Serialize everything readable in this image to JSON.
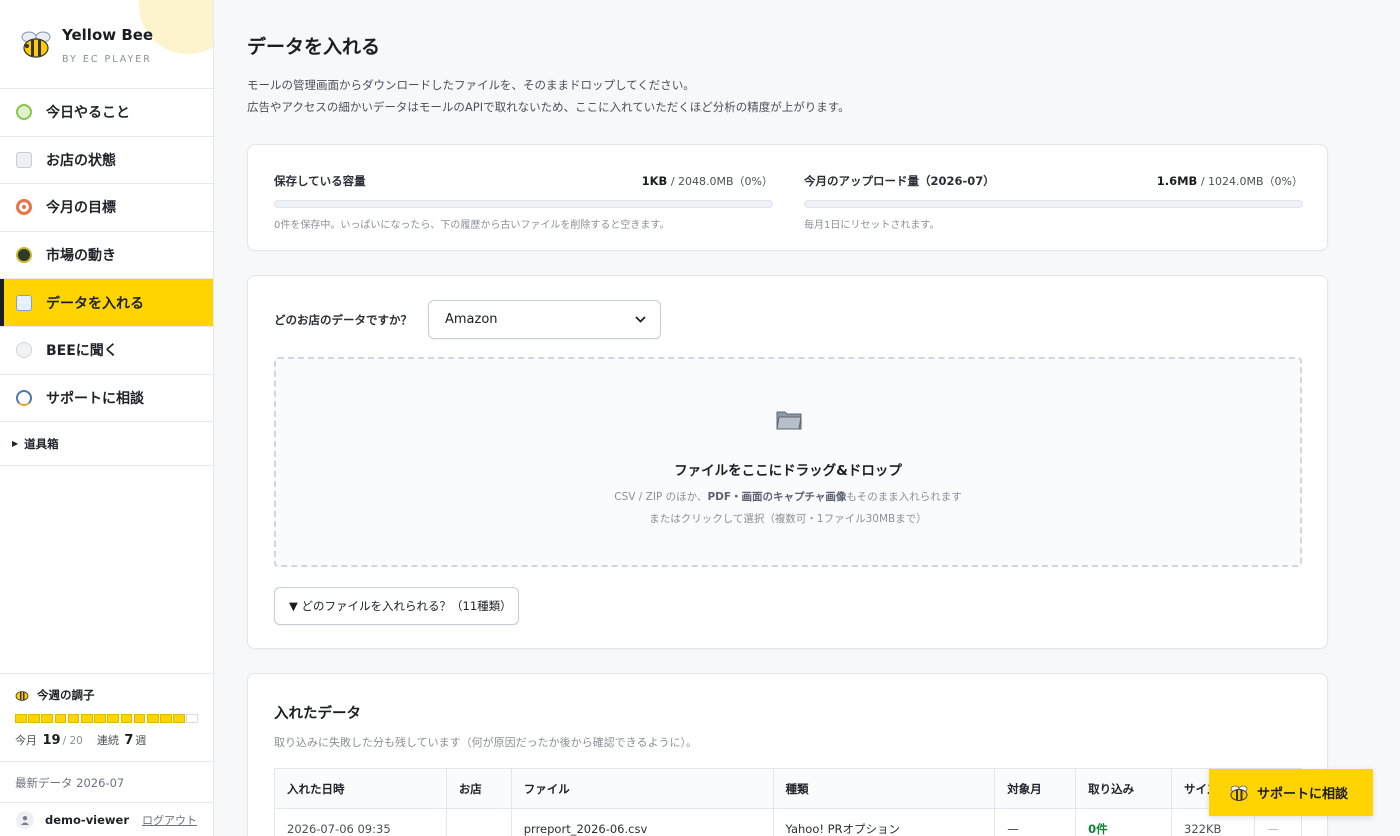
{
  "brand": {
    "name": "Yellow Bee",
    "sub": "BY EC PLAYER"
  },
  "nav": [
    {
      "label": "今日やること",
      "icon": "checkbox-icon",
      "color": "#8bc34a",
      "active": false
    },
    {
      "label": "お店の状態",
      "icon": "chart-icon",
      "color": "#c9ced6",
      "active": false
    },
    {
      "label": "今月の目標",
      "icon": "target-icon",
      "color": "#e8734a",
      "active": false
    },
    {
      "label": "市場の動き",
      "icon": "trend-icon",
      "color": "#2f3a2a",
      "active": false
    },
    {
      "label": "データを入れる",
      "icon": "inbox-icon",
      "color": "#6fa8dc",
      "active": true
    },
    {
      "label": "BEEに聞く",
      "icon": "chat-icon",
      "color": "#d0d4da",
      "active": false
    },
    {
      "label": "サポートに相談",
      "icon": "headset-icon",
      "color": "#4a7aa8",
      "active": false
    }
  ],
  "toolbox": {
    "label": "道具箱"
  },
  "weekly": {
    "title": "今週の調子",
    "segments_filled": 13,
    "segments_total": 14,
    "month_label": "今月",
    "month_value": "19",
    "month_total": "/ 20",
    "streak_label": "連続",
    "streak_value": "7",
    "streak_unit": "週"
  },
  "latest": {
    "text": "最新データ 2026-07"
  },
  "user": {
    "name": "demo-viewer",
    "logout": "ログアウト"
  },
  "page": {
    "title": "データを入れる",
    "desc1": "モールの管理画面からダウンロードしたファイルを、そのままドロップしてください。",
    "desc2": "広告やアクセスの細かいデータはモールのAPIで取れないため、ここに入れていただくほど分析の精度が上がります。"
  },
  "storage": {
    "label": "保存している容量",
    "used": "1KB",
    "total": "/ 2048.0MB（0%）",
    "percent": 0,
    "note": "0件を保存中。いっぱいになったら、下の履歴から古いファイルを削除すると空きます。"
  },
  "upload_quota": {
    "label": "今月のアップロード量（2026-07）",
    "used": "1.6MB",
    "total": "/ 1024.0MB（0%）",
    "percent": 0,
    "note": "毎月1日にリセットされます。"
  },
  "shop": {
    "label": "どのお店のデータですか？",
    "selected": "Amazon"
  },
  "dropzone": {
    "title": "ファイルをここにドラッグ&ドロップ",
    "line1_pre": "CSV / ZIP のほか、",
    "line1_bold": "PDF・画面のキャプチャ画像",
    "line1_post": "もそのまま入れられます",
    "line2": "またはクリックして選択（複数可・1ファイル30MBまで）"
  },
  "types_button": {
    "label": "▼ どのファイルを入れられる？（11種類）"
  },
  "data_section": {
    "title": "入れたデータ",
    "desc": "取り込みに失敗した分も残しています（何が原因だったか後から確認できるように）。",
    "columns": [
      "入れた日時",
      "お店",
      "ファイル",
      "種類",
      "対象月",
      "取り込み",
      "サイズ",
      ""
    ],
    "rows": [
      {
        "date": "2026-07-06 09:35",
        "shop": "",
        "file": "prreport_2026-06.csv",
        "type": "Yahoo! PRオプション",
        "month": "—",
        "imported": "0件",
        "size": "322KB",
        "action": "—"
      }
    ]
  },
  "support_float": {
    "label": "サポートに相談"
  },
  "colors": {
    "accent": "#ffd400",
    "success": "#13803a"
  }
}
